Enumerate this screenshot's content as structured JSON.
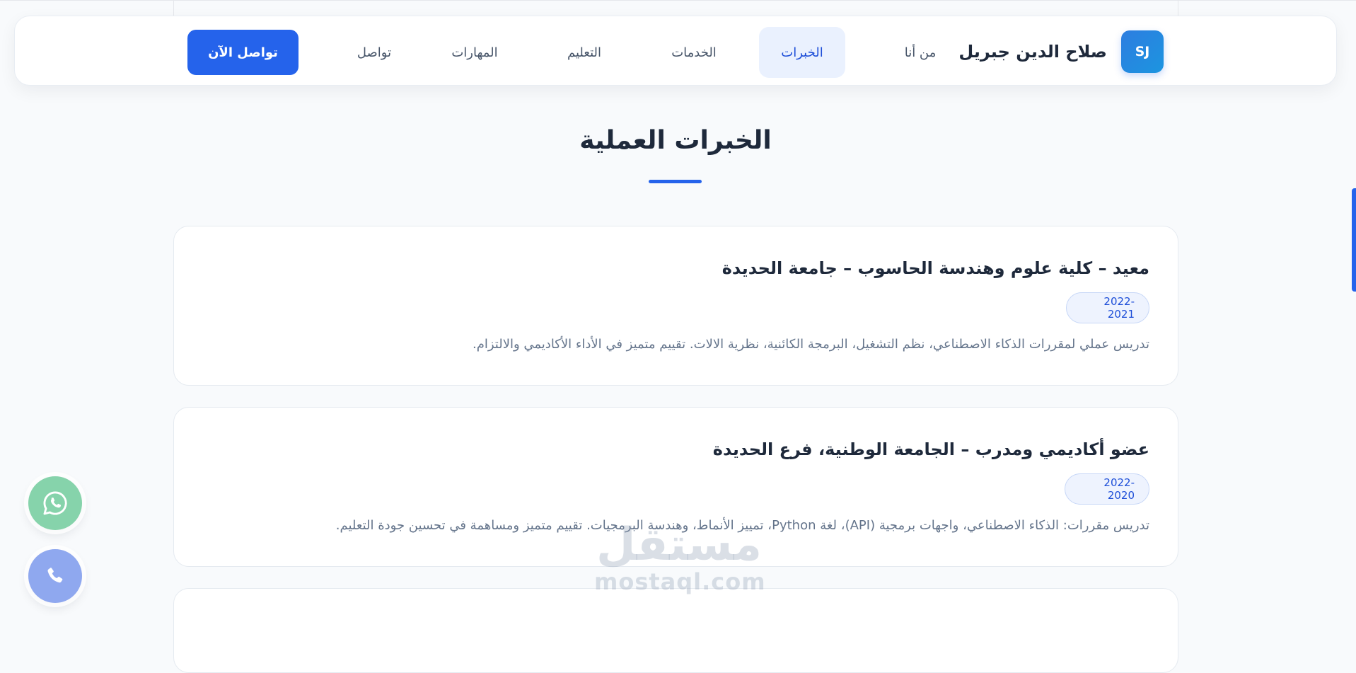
{
  "header": {
    "logo_initials": "SJ",
    "brand_name": "صلاح الدين جبريل",
    "nav": [
      {
        "label": "من أنا"
      },
      {
        "label": "الخبرات",
        "active": true
      },
      {
        "label": "الخدمات"
      },
      {
        "label": "التعليم"
      },
      {
        "label": "المهارات"
      },
      {
        "label": "تواصل"
      }
    ],
    "cta_label": "تواصل الآن"
  },
  "section": {
    "title": "الخبرات العملية"
  },
  "experiences": [
    {
      "title": "معيد – كلية علوم وهندسة الحاسوب – جامعة الحديدة",
      "period": "2022-2021",
      "description": "تدريس عملي لمقررات الذكاء الاصطناعي، نظم التشغيل، البرمجة الكائنية، نظرية الالات. تقييم متميز في الأداء الأكاديمي والالتزام."
    },
    {
      "title": "عضو أكاديمي ومدرب – الجامعة الوطنية، فرع الحديدة",
      "period": "2022-2020",
      "description": "تدريس مقررات: الذكاء الاصطناعي، واجهات برمجية (API)، لغة Python، تمييز الأنماط، وهندسة البرمجيات. تقييم متميز ومساهمة في تحسين جودة التعليم."
    }
  ],
  "floating": {
    "whatsapp_icon": "whatsapp-icon",
    "phone_icon": "phone-icon"
  },
  "watermark": {
    "arabic": "مستقل",
    "latin": "mostaql.com"
  },
  "colors": {
    "accent": "#2563eb",
    "whatsapp": "#86d3ab",
    "phone": "#8fa8ef"
  }
}
